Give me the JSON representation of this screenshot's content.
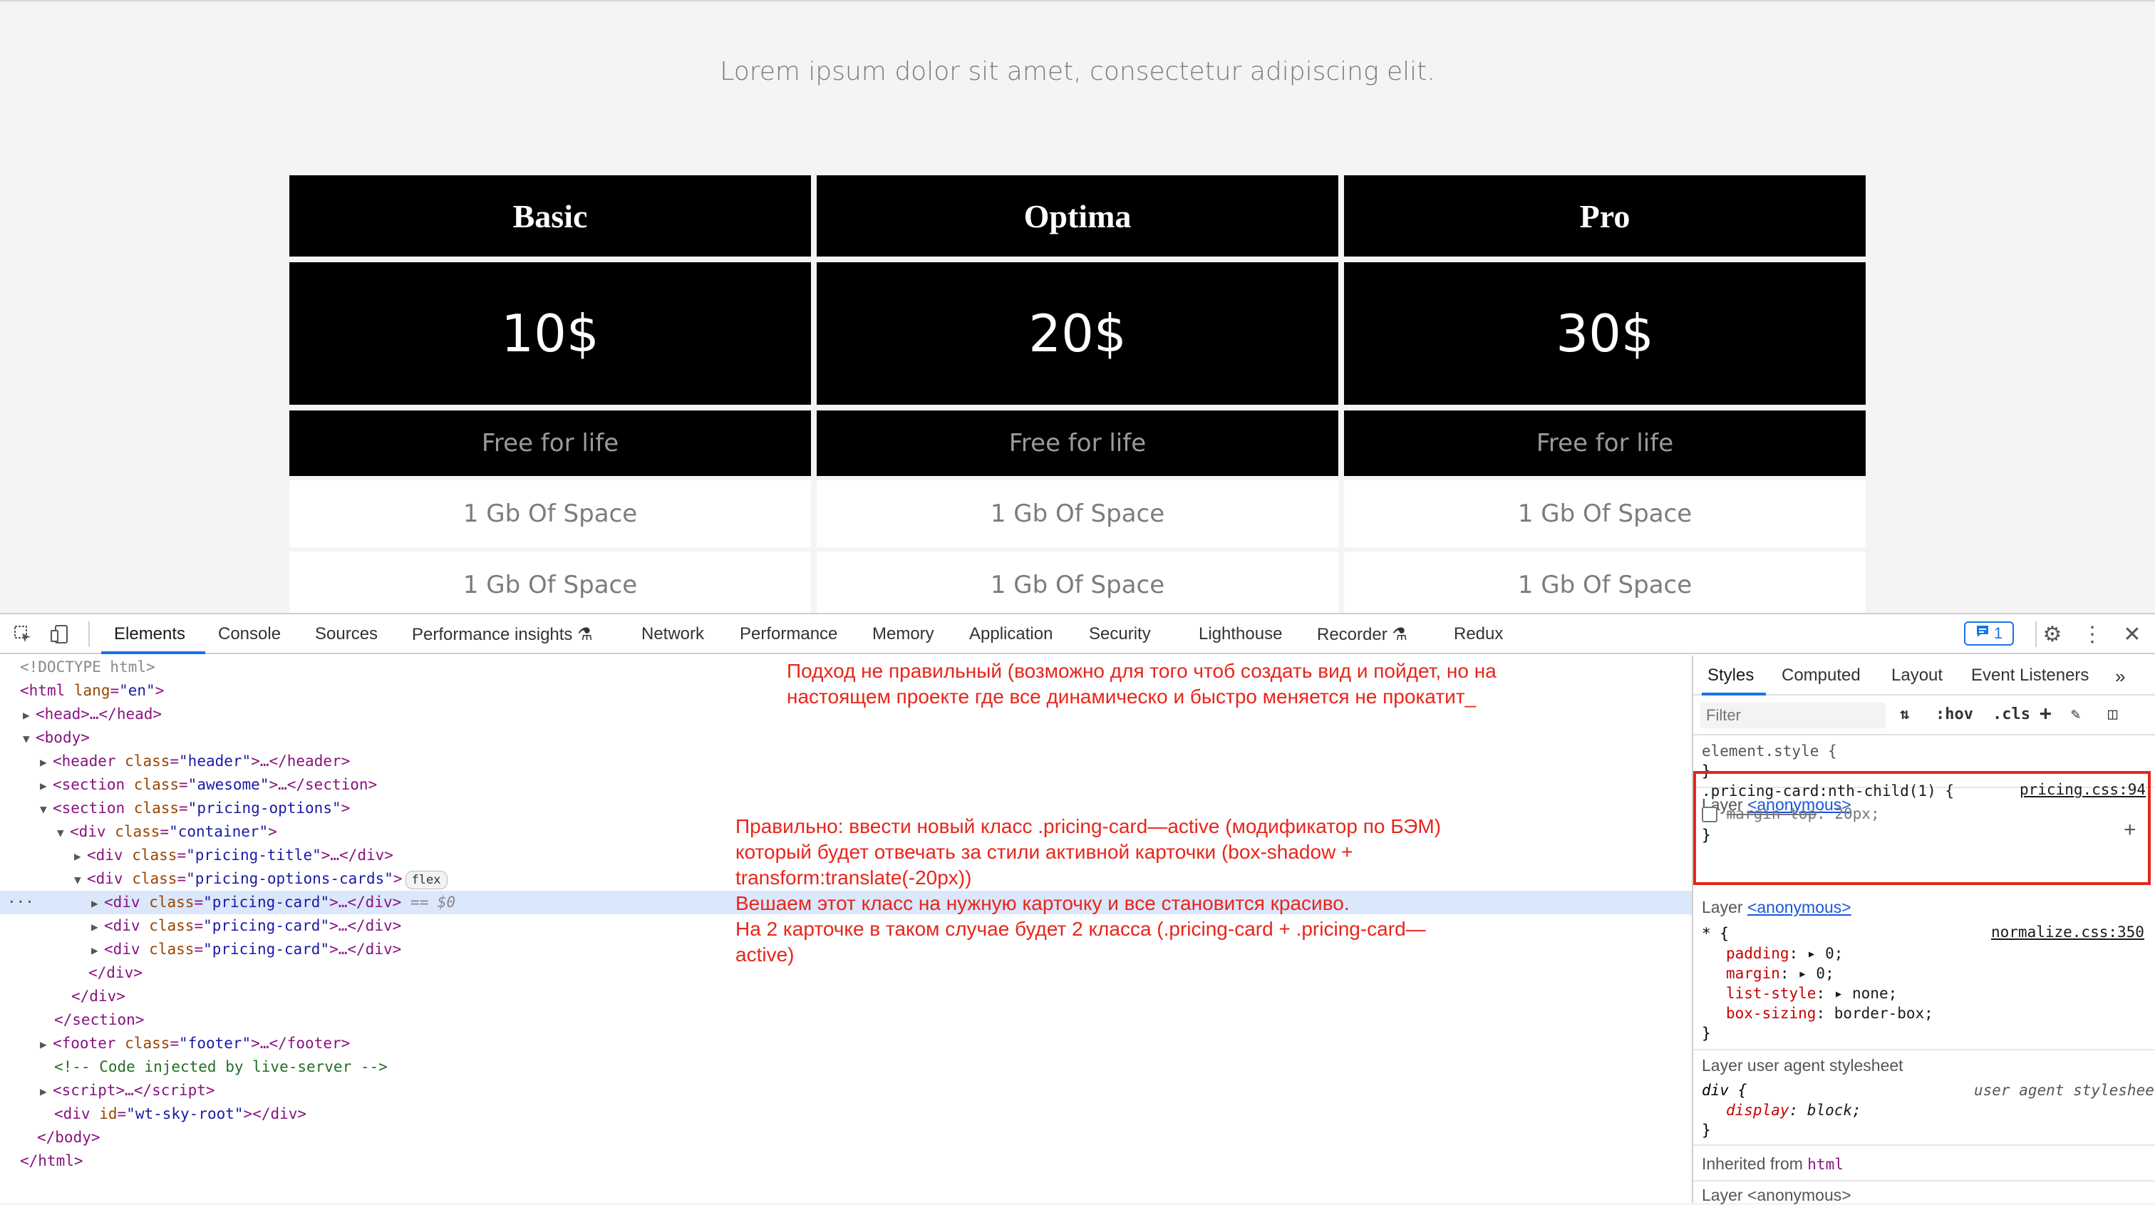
{
  "page": {
    "subtitle": "Lorem ipsum dolor sit amet, consectetur adipiscing elit.",
    "cards": [
      {
        "title": "Basic",
        "price": "10$",
        "free": "Free for life",
        "features": [
          "1 Gb Of Space",
          "1 Gb Of Space"
        ]
      },
      {
        "title": "Optima",
        "price": "20$",
        "free": "Free for life",
        "features": [
          "1 Gb Of Space",
          "1 Gb Of Space"
        ]
      },
      {
        "title": "Pro",
        "price": "30$",
        "free": "Free for life",
        "features": [
          "1 Gb Of Space",
          "1 Gb Of Space"
        ]
      }
    ]
  },
  "devtools": {
    "tabs": [
      "Elements",
      "Console",
      "Sources",
      "Performance insights",
      "Network",
      "Performance",
      "Memory",
      "Application",
      "Security",
      "Lighthouse",
      "Recorder",
      "Redux"
    ],
    "active_tab": "Elements",
    "issues_count": "1",
    "dom": {
      "doctype": "<!DOCTYPE html>",
      "html_open": "html",
      "head": "head",
      "body": "body",
      "lang_attr": "lang",
      "lang_val": "\"en\"",
      "class_attr": "class",
      "header_class": "\"header\"",
      "awesome_class": "\"awesome\"",
      "pricing_options_class": "\"pricing-options\"",
      "container_class": "\"container\"",
      "pricing_title_class": "\"pricing-title\"",
      "pricing_cards_class": "\"pricing-options-cards\"",
      "pricing_card_class": "\"pricing-card\"",
      "flex_badge": "flex",
      "selected_marker": "== $0",
      "comment": "<!-- Code injected by live-server -->",
      "id_attr": "id",
      "sky_root": "\"wt-sky-root\"",
      "ellipsis_dots": "···"
    },
    "notes": {
      "note1": "Подход не правильный (возможно для того чтоб создать вид и пойдет, но на\nнастоящем проекте где все динамическо и быстро меняется не прокатит_",
      "note2": "Правильно: ввести новый класс .pricing-card—active (модификатор по БЭМ)\nкоторый будет отвечать за стили активной карточки (box-shadow +\ntransform:translate(-20px))\nВешаем этот класс на нужную карточку и все становится красиво.\nНа 2 карточке в таком случае будет 2 класса (.pricing-card + .pricing-card—\nactive)"
    },
    "styles_pane": {
      "tabs": [
        "Styles",
        "Computed",
        "Layout",
        "Event Listeners"
      ],
      "active_tab": "Styles",
      "filter_placeholder": "Filter",
      "hov": ":hov",
      "cls": ".cls",
      "element_style": "element.style {",
      "close_brace": "}",
      "layer_label": "Layer ",
      "layer_anonymous": "<anonymous>",
      "rule1_selector": ".pricing-card:nth-child(1) {",
      "rule1_source": "pricing.css:94",
      "rule1_prop": "margin-top",
      "rule1_val": ": 20px;",
      "rule2_selector": "* {",
      "rule2_source": "normalize.css:350",
      "rule2_props": [
        {
          "prop": "padding",
          "val": ": ▸ 0;"
        },
        {
          "prop": "margin",
          "val": ": ▸ 0;"
        },
        {
          "prop": "list-style",
          "val": ": ▸ none;"
        },
        {
          "prop": "box-sizing",
          "val": ": border-box;"
        }
      ],
      "layer_ua": "Layer user agent stylesheet",
      "ua_selector": "div {",
      "ua_source": "user agent stylesheet",
      "ua_prop": "display",
      "ua_val": ": block;",
      "inherited_from": "Inherited from ",
      "inherited_tag": "html",
      "layer_bottom": "Layer <anonymous>"
    }
  },
  "colors": {
    "annotation": "#e8251b",
    "accent": "#1a73e8",
    "card_bg": "#000000"
  }
}
